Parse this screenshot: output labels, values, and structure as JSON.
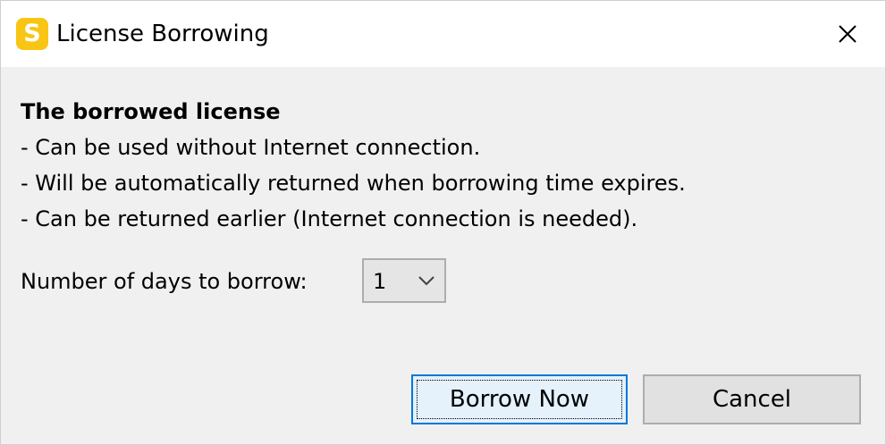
{
  "window": {
    "title": "License Borrowing",
    "app_icon_letter": "S",
    "icons": {
      "app": "app-logo-icon",
      "close": "close-icon",
      "dropdown": "chevron-down-icon"
    }
  },
  "info": {
    "heading": "The borrowed license",
    "lines": [
      "- Can be used without Internet connection.",
      "- Will be automatically returned when borrowing time expires.",
      "- Can be returned earlier (Internet connection is needed)."
    ]
  },
  "days": {
    "label": "Number of days to borrow:",
    "selected_value": "1"
  },
  "buttons": {
    "borrow_label": "Borrow Now",
    "cancel_label": "Cancel"
  },
  "colors": {
    "accent": "#0078d7",
    "app_icon": "#f9c515",
    "dialog_background": "#f0f0f0",
    "titlebar_background": "#ffffff"
  }
}
